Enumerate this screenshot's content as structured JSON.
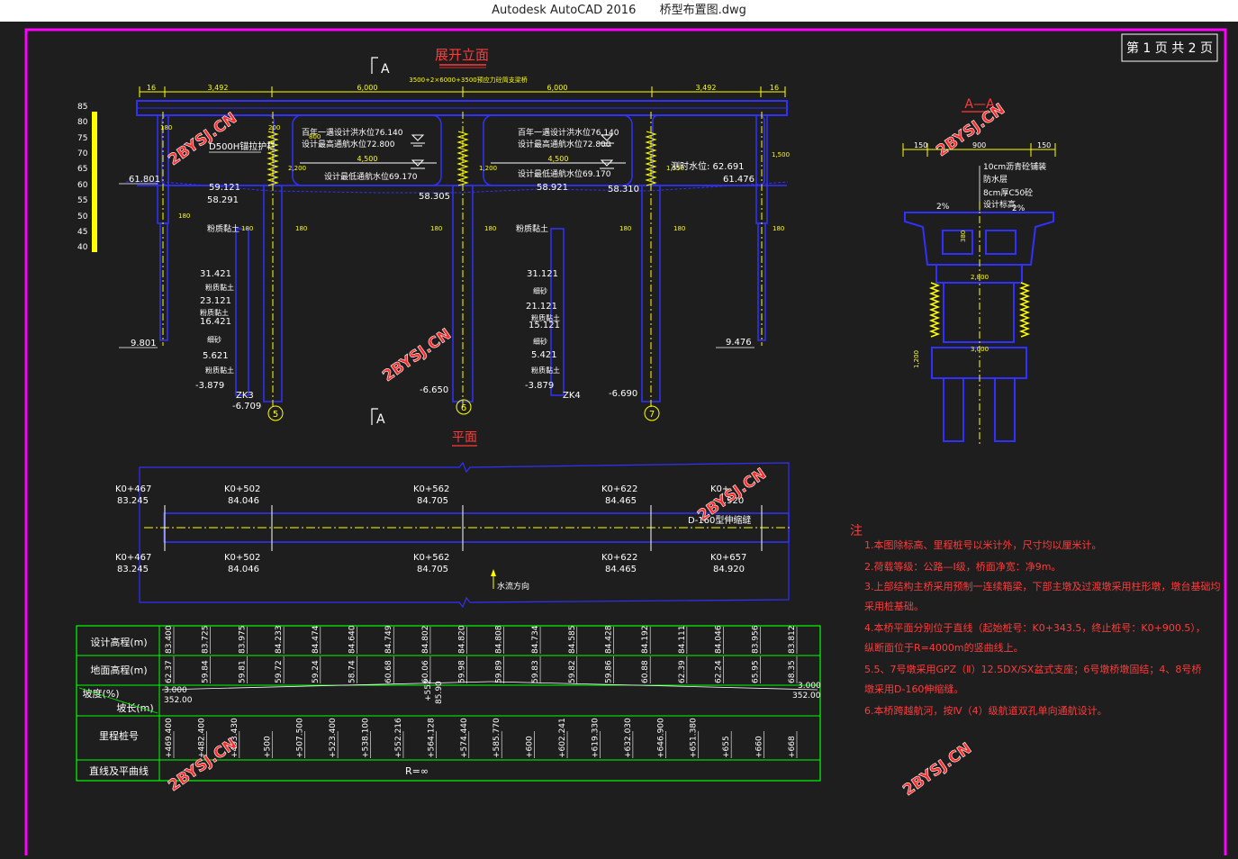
{
  "window": {
    "app_title": "Autodesk AutoCAD 2016",
    "file_title": "桥型布置图.dwg"
  },
  "page_badge": "第 1 页   共 2 页",
  "colors": {
    "frame": "#ff00ff",
    "structure": "#2020ff",
    "dimension": "#ffff00",
    "note": "#ff3b3b",
    "table": "#00ff00",
    "background": "#1e1e1e"
  },
  "elevation": {
    "title": "展开立面",
    "section_mark": "A",
    "overall_dim": "3500+2×6000+3500预应力砼简支梁桥",
    "dims": [
      "16",
      "3,492",
      "6,000",
      "6,000",
      "3,492",
      "16"
    ],
    "scale_ticks": [
      "85",
      "80",
      "75",
      "70",
      "65",
      "60",
      "55",
      "50",
      "45",
      "40"
    ],
    "water_levels": [
      {
        "label": "百年一遇设计洪水位76.140"
      },
      {
        "label": "设计最高通航水位72.800"
      },
      {
        "label": "设计最低通航水位69.170"
      },
      {
        "label": "百年一遇设计洪水位76.140"
      },
      {
        "label": "设计最高通航水位72.800"
      },
      {
        "label": "设计最低通航水位69.170"
      }
    ],
    "spacing_4500": [
      "4,500",
      "4,500"
    ],
    "measure_level": "测时水位: 62.691",
    "anchor": "D500H锚拉护栏",
    "elev_left": [
      "61.801",
      "59.121",
      "58.291",
      "9.801"
    ],
    "elev_right": [
      "61.476",
      "58.310",
      "9.476"
    ],
    "elev_mid": [
      "58.305",
      "58.921"
    ],
    "pile_bottoms": [
      "-6.709",
      "-6.650",
      "-6.690"
    ],
    "borehole_left": {
      "name": "ZK3",
      "levels": [
        "31.421",
        "23.121",
        "16.421",
        "5.621",
        "-3.879"
      ],
      "soils": [
        "粉质黏土",
        "细砂",
        "粉质黏土",
        "细砂",
        "粉质黏土"
      ]
    },
    "borehole_right": {
      "name": "ZK4",
      "levels": [
        "31.121",
        "21.121",
        "15.121",
        "5.421",
        "-3.879"
      ],
      "soils": [
        "粉质黏土",
        "细砂",
        "粉质黏土",
        "细砂",
        "粉质黏土"
      ]
    },
    "piers": [
      "5",
      "6",
      "7"
    ],
    "small_dims": [
      "180",
      "200",
      "800",
      "2,200",
      "1,200",
      "1,550",
      "1,500"
    ]
  },
  "section_aa": {
    "title": "A—A",
    "dims_top": [
      "150",
      "900",
      "150"
    ],
    "layers": [
      "10cm沥青砼铺装",
      "防水层",
      "8cm厚C50砼",
      "设计标高"
    ],
    "slopes": [
      "2%",
      "2%"
    ],
    "dims_body": [
      "380",
      "2,800",
      "3,000",
      "1,200"
    ]
  },
  "plan": {
    "title": "平面",
    "stations_top": [
      {
        "k": "K0+467",
        "v": "83.245"
      },
      {
        "k": "K0+502",
        "v": "84.046"
      },
      {
        "k": "K0+562",
        "v": "84.705"
      },
      {
        "k": "K0+622",
        "v": "84.465"
      },
      {
        "k": "K0+",
        "v": ".920"
      }
    ],
    "stations_bot": [
      {
        "k": "K0+467",
        "v": "83.245"
      },
      {
        "k": "K0+502",
        "v": "84.046"
      },
      {
        "k": "K0+562",
        "v": "84.705"
      },
      {
        "k": "K0+622",
        "v": "84.465"
      },
      {
        "k": "K0+657",
        "v": "84.920"
      }
    ],
    "joint": "D-160型伸缩缝",
    "flow": "水流方向"
  },
  "table": {
    "rows": [
      "设计高程(m)",
      "地面高程(m)",
      "坡度(%)",
      "坡长(m)",
      "里程桩号",
      "直线及平曲线"
    ],
    "design_elev": [
      "83.400",
      "83.725",
      "83.975",
      "84.233",
      "84.474",
      "84.640",
      "84.749",
      "84.802",
      "84.820",
      "84.808",
      "84.734",
      "84.585",
      "84.428",
      "84.192",
      "84.111",
      "84.046",
      "83.956",
      "83.812"
    ],
    "ground_elev": [
      "62.37",
      "59.84",
      "59.81",
      "59.72",
      "59.24",
      "58.74",
      "60.68",
      "60.06",
      "59.98",
      "59.89",
      "59.83",
      "59.82",
      "59.86",
      "60.88",
      "62.39",
      "62.24",
      "65.95",
      "68.35"
    ],
    "grade_left": "3.000",
    "grade_right": "3.000",
    "len_left": "352.00",
    "len_right": "352.00",
    "vc_station": "+552",
    "vc_elev": "85.90",
    "stations": [
      "+469.400",
      "+482.400",
      "+493.430",
      "+500",
      "+507.500",
      "+523.400",
      "+538.100",
      "+552.216",
      "+564.128",
      "+574.440",
      "+585.770",
      "+600",
      "+602.241",
      "+619.330",
      "+632.030",
      "+646.900",
      "+651.380",
      "+655",
      "+660",
      "+668"
    ],
    "curve": "R=∞"
  },
  "notes": {
    "title": "注",
    "items": [
      "1.本图除标高、里程桩号以米计外，尺寸均以厘米计。",
      "2.荷载等级：公路—Ⅰ级，桥面净宽：净9m。",
      "3.上部结构主桥采用预制一连续箱梁，下部主墩及过渡墩采用柱形墩，墩台基础均",
      "采用桩基础。",
      "4.本桥平面分别位于直线（起始桩号：K0+343.5，终止桩号：K0+900.5），",
      "纵断面位于R=4000m的竖曲线上。",
      "5.5、7号墩采用GPZ（Ⅱ）12.5DX/SX盆式支座；6号墩桥墩固结；4、8号桥",
      "墩采用D-160伸缩缝。",
      "6.本桥跨越航河，按Ⅳ（4）级航道双孔单向通航设计。"
    ]
  },
  "watermark": "2BYSJ.CN"
}
